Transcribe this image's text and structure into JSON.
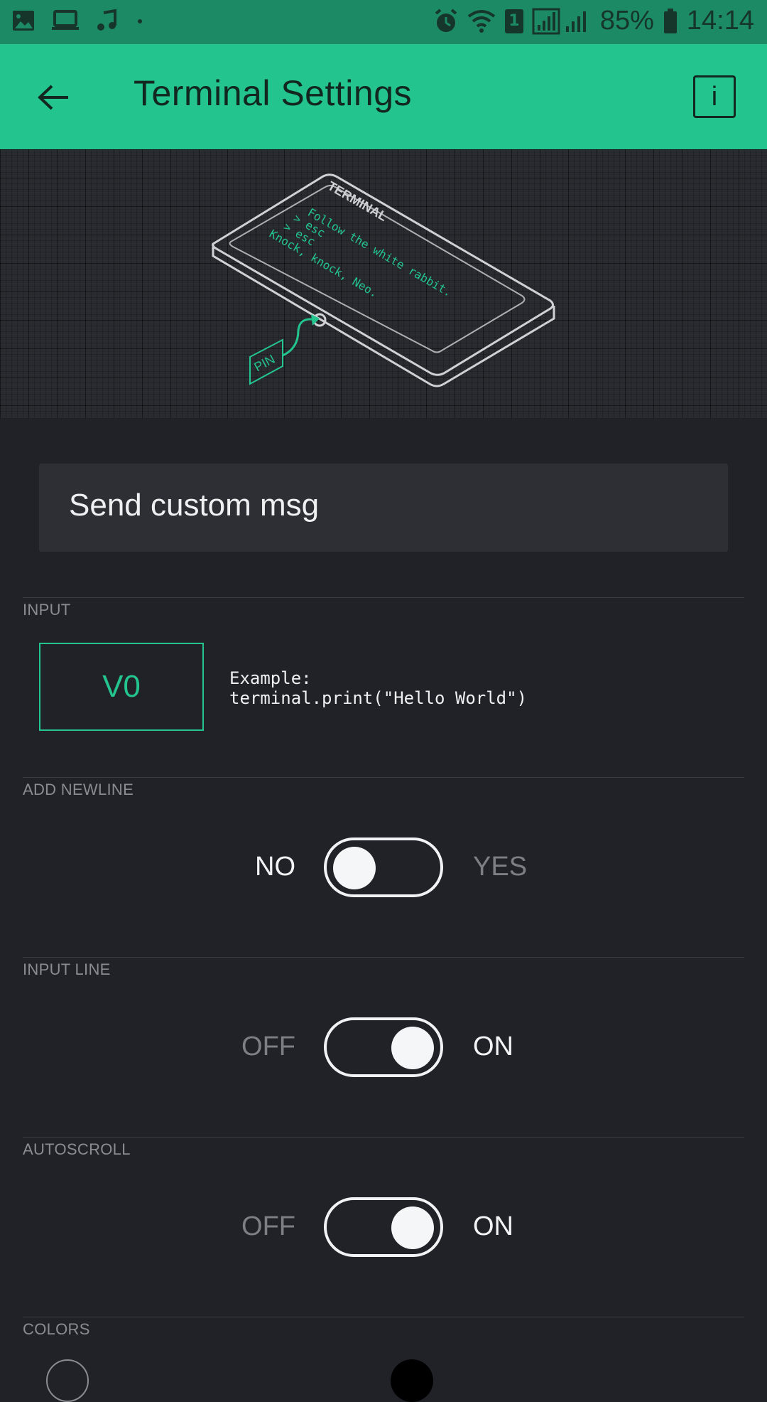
{
  "status_bar": {
    "battery_percent": "85%",
    "time": "14:14",
    "sim_slot": "1",
    "icons": [
      "image-icon",
      "laptop-icon",
      "music-icon",
      "dot-icon",
      "alarm-icon",
      "wifi-icon",
      "sim-icon",
      "signal-icon",
      "battery-icon"
    ]
  },
  "app_bar": {
    "title": "Terminal Settings",
    "info_label": "i"
  },
  "hero": {
    "device_label": "TERMINAL",
    "lines": [
      "Follow the white rabbit.",
      "> esc",
      "> esc",
      "Knock, knock, Neo."
    ],
    "pin_label": "PIN",
    "accent_color": "#23c48e"
  },
  "name_field": {
    "value": "Send custom msg"
  },
  "input_section": {
    "label": "INPUT",
    "pin_value": "V0",
    "example_line1": "Example:",
    "example_line2": "terminal.print(\"Hello World\")"
  },
  "newline_section": {
    "label": "ADD NEWLINE",
    "off_label": "NO",
    "on_label": "YES",
    "state": "off"
  },
  "input_line_section": {
    "label": "INPUT LINE",
    "off_label": "OFF",
    "on_label": "ON",
    "state": "on"
  },
  "autoscroll_section": {
    "label": "AUTOSCROLL",
    "off_label": "OFF",
    "on_label": "ON",
    "state": "on"
  },
  "colors_section": {
    "label": "COLORS"
  },
  "theme": {
    "accent": "#23c48e",
    "background": "#212227",
    "status_bar": "#1d8a66"
  }
}
